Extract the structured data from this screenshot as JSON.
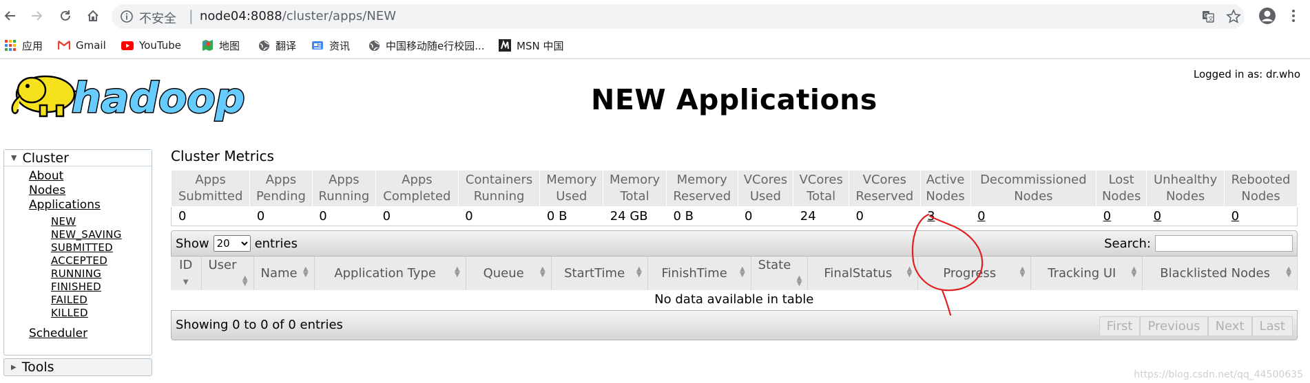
{
  "browser": {
    "security_label": "不安全",
    "url_separator": "|",
    "url_host": "node04:8088",
    "url_path": "/cluster/apps/NEW"
  },
  "bookmarks": [
    {
      "label": "应用",
      "icon": "apps-grid-icon"
    },
    {
      "label": "Gmail",
      "icon": "gmail-icon"
    },
    {
      "label": "YouTube",
      "icon": "youtube-icon"
    },
    {
      "label": "地图",
      "icon": "maps-icon"
    },
    {
      "label": "翻译",
      "icon": "globe-icon"
    },
    {
      "label": "资讯",
      "icon": "news-icon"
    },
    {
      "label": "中国移动随e行校园...",
      "icon": "globe-icon"
    },
    {
      "label": "MSN 中国",
      "icon": "msn-icon"
    }
  ],
  "header": {
    "logged_in": "Logged in as: dr.who",
    "title": "NEW Applications",
    "logo_text": "hadoop"
  },
  "sidebar": {
    "cluster_label": "Cluster",
    "links": [
      "About",
      "Nodes",
      "Applications"
    ],
    "app_states": [
      "NEW",
      "NEW_SAVING",
      "SUBMITTED",
      "ACCEPTED",
      "RUNNING",
      "FINISHED",
      "FAILED",
      "KILLED"
    ],
    "scheduler": "Scheduler",
    "tools_label": "Tools"
  },
  "metrics": {
    "title": "Cluster Metrics",
    "headers": [
      [
        "Apps",
        "Submitted"
      ],
      [
        "Apps",
        "Pending"
      ],
      [
        "Apps",
        "Running"
      ],
      [
        "Apps",
        "Completed"
      ],
      [
        "Containers",
        "Running"
      ],
      [
        "Memory",
        "Used"
      ],
      [
        "Memory",
        "Total"
      ],
      [
        "Memory",
        "Reserved"
      ],
      [
        "VCores",
        "Used"
      ],
      [
        "VCores",
        "Total"
      ],
      [
        "VCores",
        "Reserved"
      ],
      [
        "Active",
        "Nodes"
      ],
      [
        "Decommissioned",
        "Nodes"
      ],
      [
        "Lost",
        "Nodes"
      ],
      [
        "Unhealthy",
        "Nodes"
      ],
      [
        "Rebooted",
        "Nodes"
      ]
    ],
    "values": [
      "0",
      "0",
      "0",
      "0",
      "0",
      "0 B",
      "24 GB",
      "0 B",
      "0",
      "24",
      "0",
      "3",
      "0",
      "0",
      "0",
      "0"
    ]
  },
  "apps_table": {
    "show_label": "Show",
    "entries_label": "entries",
    "page_size": "20",
    "search_label": "Search:",
    "search_value": "",
    "columns": [
      "ID",
      "User",
      "Name",
      "Application Type",
      "Queue",
      "StartTime",
      "FinishTime",
      "State",
      "FinalStatus",
      "Progress",
      "Tracking UI",
      "Blacklisted Nodes"
    ],
    "empty_message": "No data available in table",
    "info": "Showing 0 to 0 of 0 entries",
    "pager": [
      "First",
      "Previous",
      "Next",
      "Last"
    ]
  },
  "watermark": "https://blog.csdn.net/qq_44500635",
  "colors": {
    "annotation": "#e02020",
    "header_bg": "#eaeaea",
    "hadoop_yellow": "#f5e11c",
    "hadoop_blue": "#66ccff"
  }
}
